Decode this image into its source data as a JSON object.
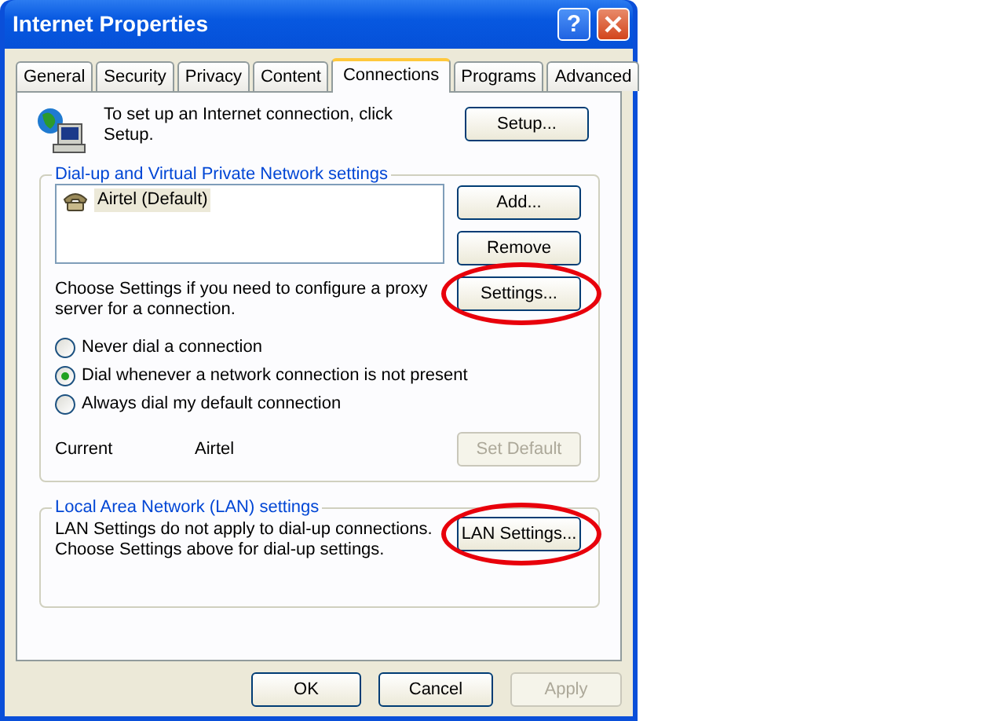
{
  "window": {
    "title": "Internet Properties",
    "help_button": "?"
  },
  "tabs": [
    {
      "label": "General",
      "selected": false
    },
    {
      "label": "Security",
      "selected": false
    },
    {
      "label": "Privacy",
      "selected": false
    },
    {
      "label": "Content",
      "selected": false
    },
    {
      "label": "Connections",
      "selected": true
    },
    {
      "label": "Programs",
      "selected": false
    },
    {
      "label": "Advanced",
      "selected": false
    }
  ],
  "setup": {
    "text": "To set up an Internet connection, click Setup.",
    "button": {
      "label": "Setup...",
      "disabled": false,
      "highlighted": false
    }
  },
  "dialup": {
    "title": "Dial-up and Virtual Private Network settings",
    "connections": [
      {
        "label": "Airtel (Default)",
        "selected": true
      }
    ],
    "buttons": [
      {
        "label": "Add...",
        "disabled": false,
        "highlighted": false
      },
      {
        "label": "Remove",
        "disabled": false,
        "highlighted": false
      }
    ],
    "proxy_text": "Choose Settings if you need to configure a proxy server for a connection.",
    "settings_button": {
      "label": "Settings...",
      "disabled": false,
      "highlighted": true
    },
    "options": [
      {
        "label": "Never dial a connection",
        "selected": false
      },
      {
        "label": "Dial whenever a network connection is not present",
        "selected": true
      },
      {
        "label": "Always dial my default connection",
        "selected": false
      }
    ],
    "current_label": "Current",
    "current_value": "Airtel",
    "set_default_button": {
      "label": "Set Default",
      "disabled": true,
      "highlighted": false
    }
  },
  "lan": {
    "title": "Local Area Network (LAN) settings",
    "text": "LAN Settings do not apply to dial-up connections. Choose Settings above for dial-up settings.",
    "button": {
      "label": "LAN Settings...",
      "disabled": false,
      "highlighted": true
    }
  },
  "footer_buttons": [
    {
      "label": "OK",
      "disabled": false,
      "highlighted": false
    },
    {
      "label": "Cancel",
      "disabled": false,
      "highlighted": false
    },
    {
      "label": "Apply",
      "disabled": true,
      "highlighted": false
    }
  ]
}
